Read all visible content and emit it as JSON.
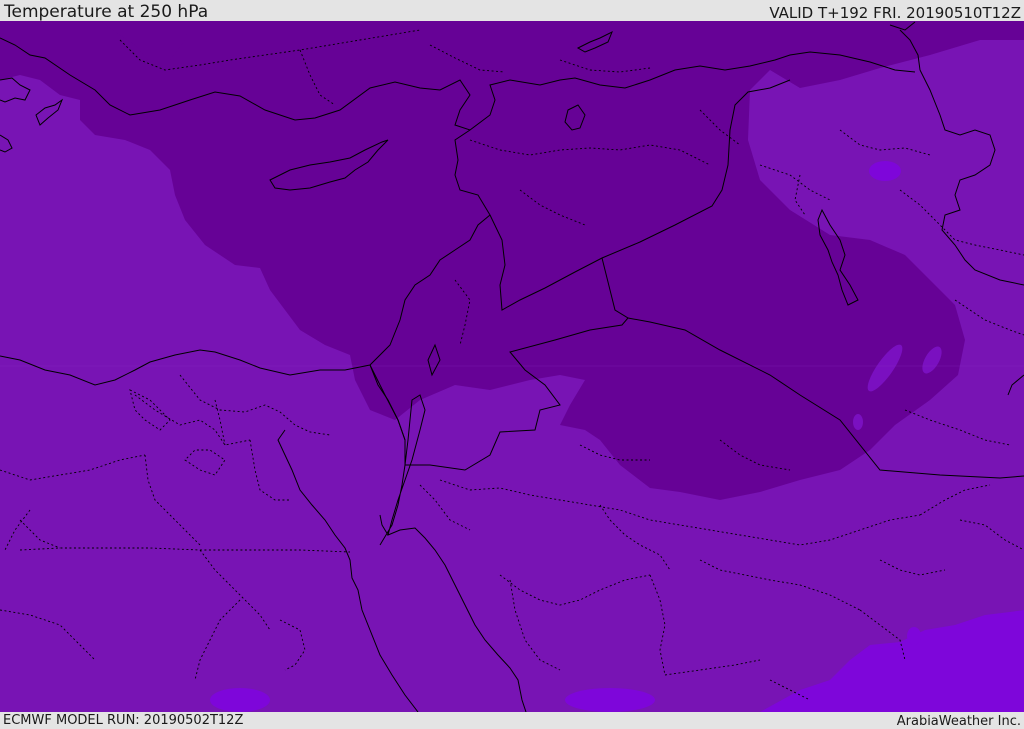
{
  "header": {
    "title": "Temperature at 250 hPa",
    "valid": "VALID T+192 FRI. 20190510T12Z"
  },
  "footer": {
    "model_run": "ECMWF MODEL RUN: 20190502T12Z",
    "credit": "ArabiaWeather Inc."
  },
  "map": {
    "variable": "Temperature",
    "level": "250 hPa",
    "colors": {
      "base_field": "#7814b4",
      "cold_field": "#660296",
      "warm_field": "#7e06da",
      "coastline": "#000000"
    }
  }
}
